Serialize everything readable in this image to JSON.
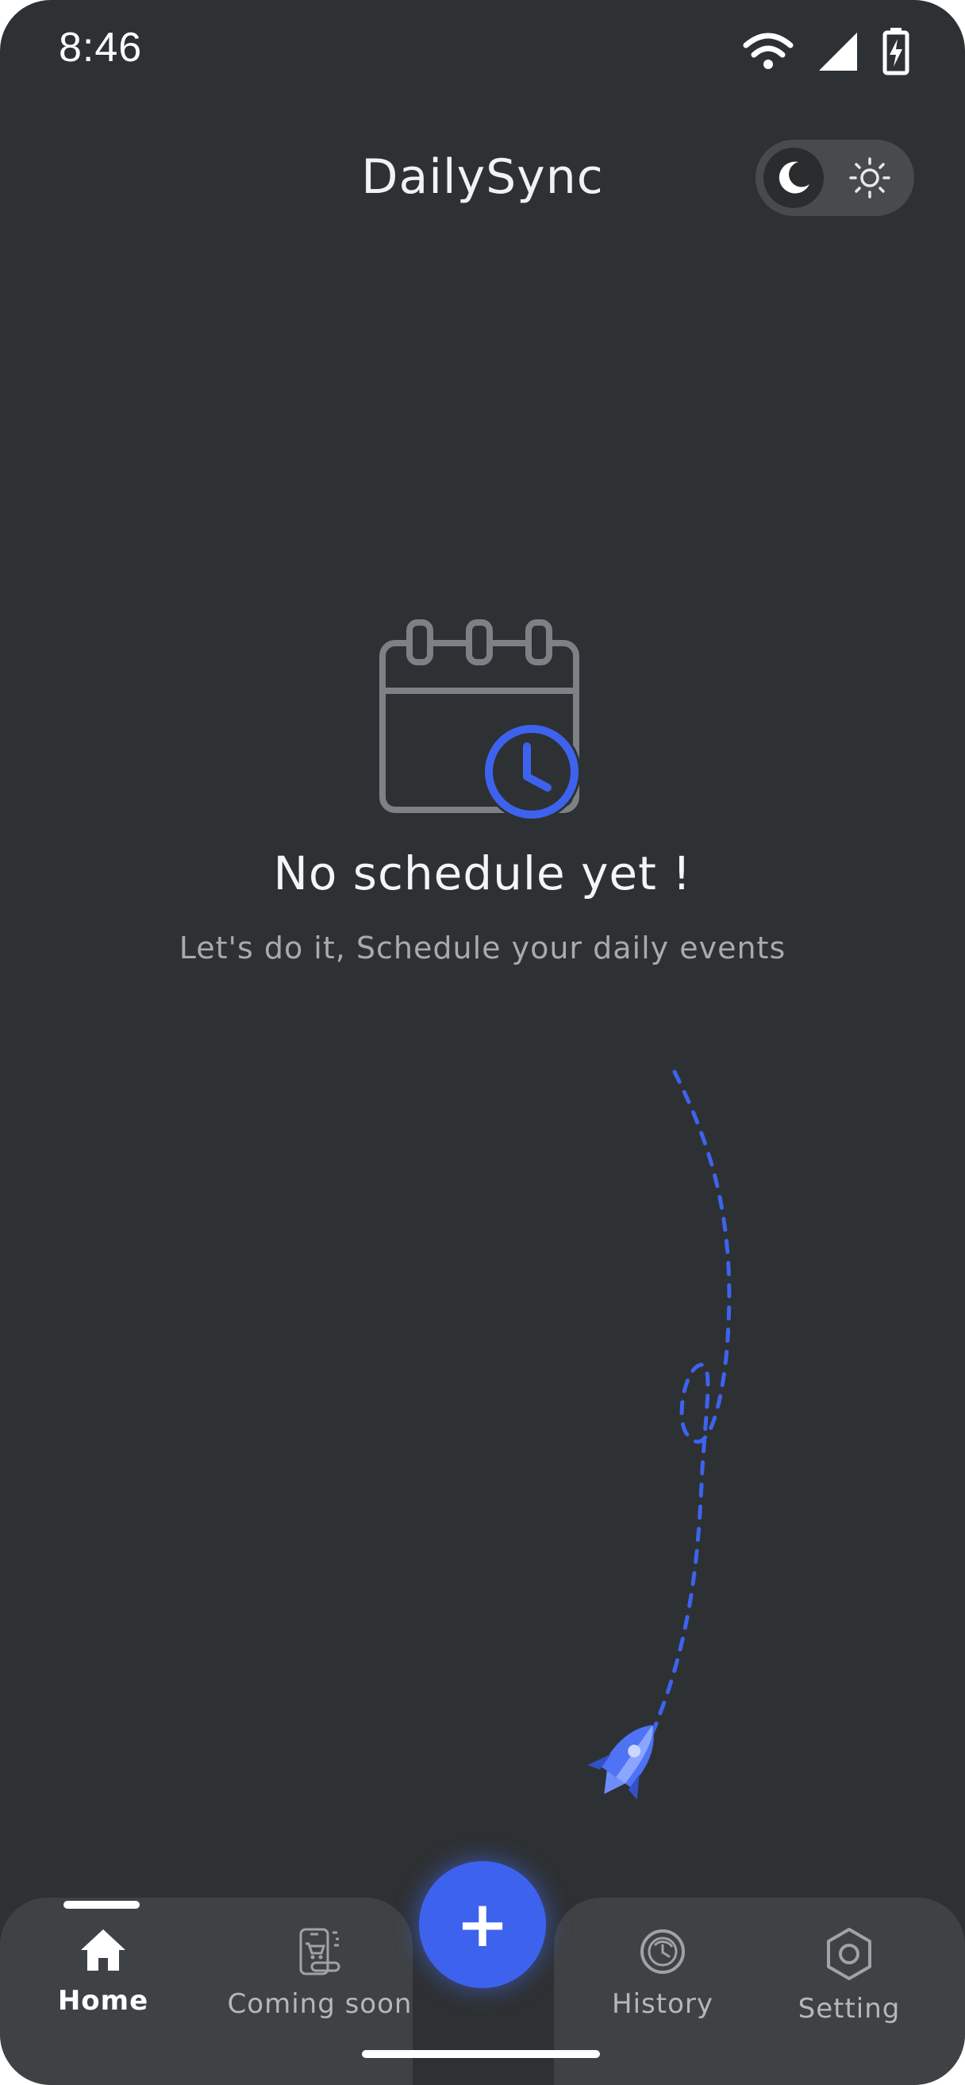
{
  "status_bar": {
    "time": "8:46",
    "icons": [
      "wifi-icon",
      "signal-icon",
      "battery-charging-icon"
    ]
  },
  "header": {
    "title": "DailySync",
    "theme_toggle": {
      "mode": "dark",
      "icons": [
        "moon-icon",
        "sun-icon"
      ]
    }
  },
  "empty_state": {
    "icon": "calendar-clock-icon",
    "title": "No schedule yet !",
    "subtitle": "Let's do it, Schedule your daily events"
  },
  "illustration": {
    "icon": "rocket-icon"
  },
  "colors": {
    "background": "#2e3133",
    "accent": "#3d63ee",
    "nav_background": "#3f4244",
    "muted_text": "#a8abae"
  },
  "bottom_nav": {
    "items": [
      {
        "label": "Home",
        "icon": "home-icon",
        "active": true
      },
      {
        "label": "Coming soon",
        "icon": "shop-phone-icon",
        "active": false
      },
      {
        "label": "History",
        "icon": "history-icon",
        "active": false
      },
      {
        "label": "Setting",
        "icon": "settings-hexagon-icon",
        "active": false
      }
    ],
    "fab": {
      "label": "+"
    }
  }
}
